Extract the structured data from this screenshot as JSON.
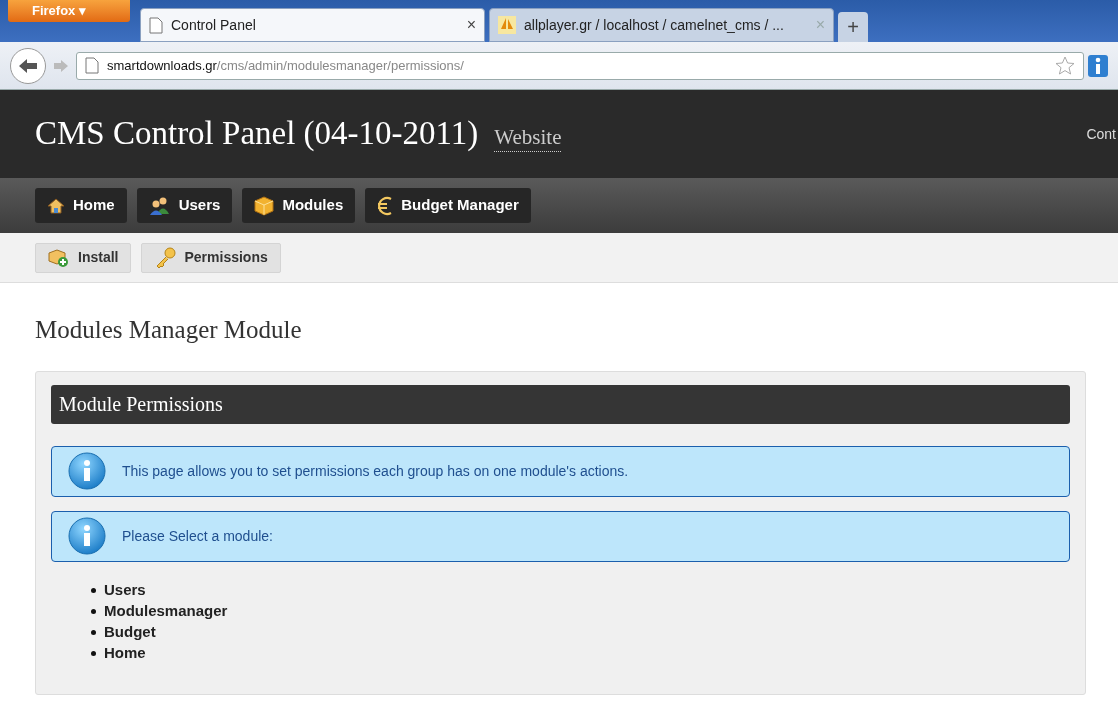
{
  "browser": {
    "menu_button": "Firefox ▾",
    "tabs": [
      {
        "label": "Control Panel",
        "selected": true,
        "close": "×"
      },
      {
        "label": "allplayer.gr / localhost / camelnet_cms / ...",
        "selected": false,
        "close": "×"
      }
    ],
    "new_tab": "+",
    "url_host": "smartdownloads.gr",
    "url_path": "/cms/admin/modulesmanager/permissions/"
  },
  "header": {
    "title": "CMS Control Panel (04-10-2011)",
    "site_link": "Website",
    "right_text": "Cont"
  },
  "nav": [
    {
      "label": "Home"
    },
    {
      "label": "Users"
    },
    {
      "label": "Modules"
    },
    {
      "label": "Budget Manager"
    }
  ],
  "subnav": [
    {
      "label": "Install"
    },
    {
      "label": "Permissions"
    }
  ],
  "page_title": "Modules Manager Module",
  "panel": {
    "title": "Module Permissions",
    "notices": [
      "This page allows you to set permissions each group has on one module's actions.",
      "Please Select a module:"
    ],
    "modules": [
      "Users",
      "Modulesmanager",
      "Budget",
      "Home"
    ]
  }
}
